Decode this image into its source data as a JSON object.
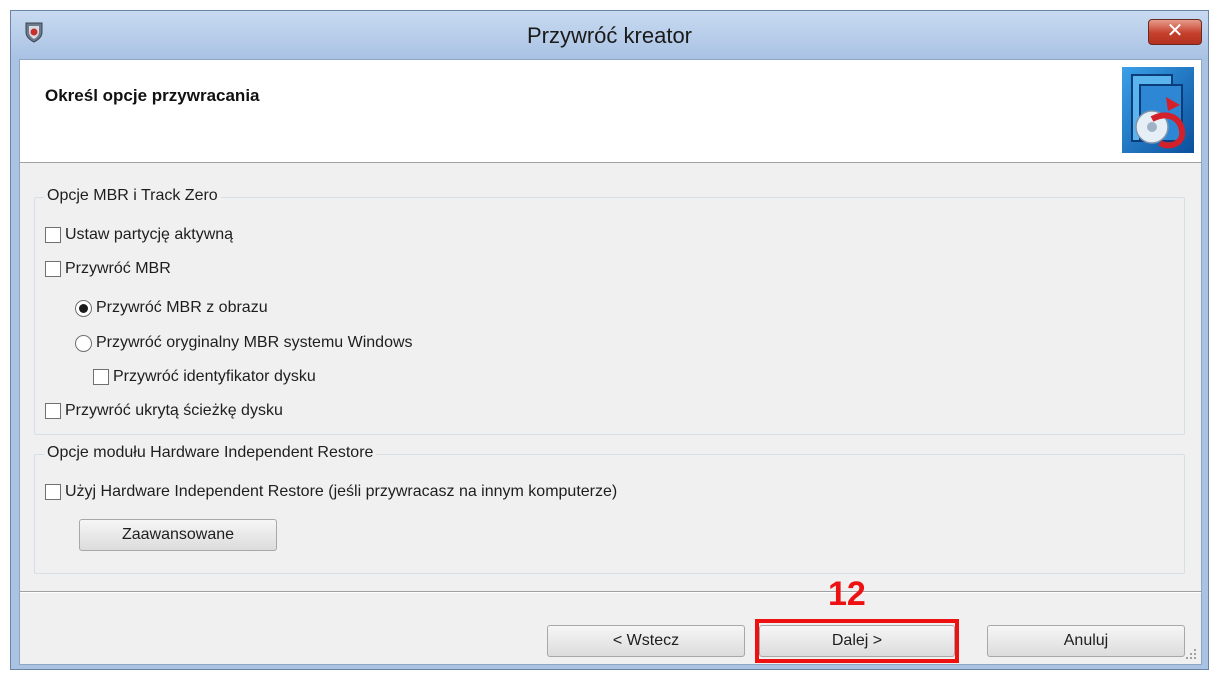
{
  "window": {
    "title": "Przywróć kreator",
    "close_label": "✕"
  },
  "header": {
    "title": "Określ opcje przywracania"
  },
  "mbr_group": {
    "legend": "Opcje MBR i Track Zero",
    "set_active_partition": {
      "label": "Ustaw partycję aktywną",
      "checked": false
    },
    "restore_mbr": {
      "label": "Przywróć MBR",
      "checked": false
    },
    "restore_mbr_from_image": {
      "label": "Przywróć MBR z obrazu",
      "selected": true
    },
    "restore_original_windows_mbr": {
      "label": "Przywróć oryginalny MBR systemu Windows",
      "selected": false
    },
    "restore_disk_signature": {
      "label": "Przywróć identyfikator dysku",
      "checked": false
    },
    "restore_hidden_track": {
      "label": "Przywróć ukrytą ścieżkę dysku",
      "checked": false
    }
  },
  "hir_group": {
    "legend": "Opcje modułu Hardware Independent Restore",
    "use_hir": {
      "label": "Użyj Hardware Independent Restore (jeśli przywracasz na innym komputerze)",
      "checked": false
    },
    "advanced_label": "Zaawansowane"
  },
  "footer": {
    "back_label": "< Wstecz",
    "next_label": "Dalej >",
    "cancel_label": "Anuluj"
  },
  "annotation": {
    "step_number": "12",
    "color": "#ee1111"
  }
}
